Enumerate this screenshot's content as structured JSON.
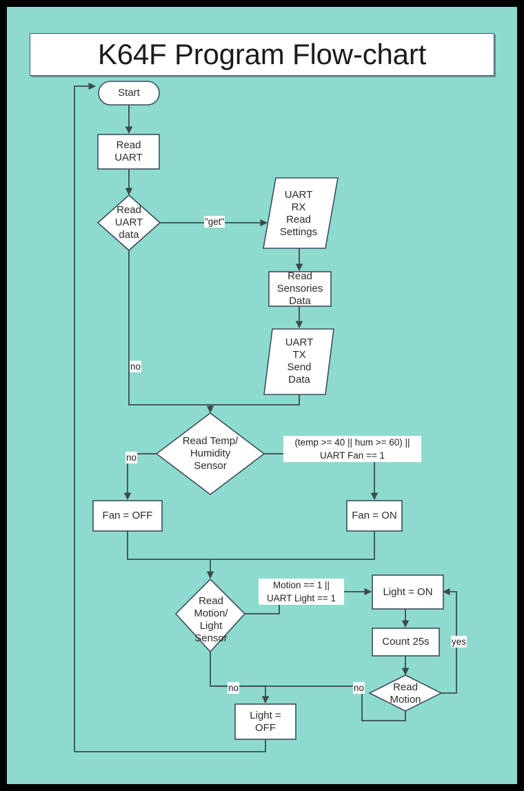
{
  "page": {
    "background_color": "#8ddbce",
    "border_color": "#000000",
    "shape_fill": "#ffffff",
    "shape_stroke": "#3f4a60",
    "connector_color": "#3c4a4a",
    "text_color": "#2b2b2b"
  },
  "title": {
    "text": "K64F Program Flow-chart"
  },
  "nodes": [
    {
      "id": "start",
      "type": "terminator",
      "label": "Start"
    },
    {
      "id": "read_uart",
      "type": "process",
      "label": "Read\nUART"
    },
    {
      "id": "read_uart_data",
      "type": "decision",
      "label": "Read\nUART\ndata"
    },
    {
      "id": "uart_rx",
      "type": "data",
      "label": "UART\nRX\nRead\nSettings"
    },
    {
      "id": "read_sensors",
      "type": "process",
      "label": "Read\nSensories\nData"
    },
    {
      "id": "uart_tx",
      "type": "data",
      "label": "UART\nTX\nSend\nData"
    },
    {
      "id": "read_temp",
      "type": "decision",
      "label": "Read Temp/\nHumidity\nSensor"
    },
    {
      "id": "fan_off",
      "type": "process",
      "label": "Fan = OFF"
    },
    {
      "id": "fan_on",
      "type": "process",
      "label": "Fan = ON"
    },
    {
      "id": "read_motion_light",
      "type": "decision",
      "label": "Read\nMotion/\nLight\nSensor"
    },
    {
      "id": "light_on",
      "type": "process",
      "label": "Light = ON"
    },
    {
      "id": "count_25s",
      "type": "process",
      "label": "Count 25s"
    },
    {
      "id": "read_motion",
      "type": "decision",
      "label": "Read\nMotion"
    },
    {
      "id": "light_off",
      "type": "process",
      "label": "Light =\nOFF"
    }
  ],
  "edge_labels": [
    {
      "id": "get",
      "text": "\"get\""
    },
    {
      "id": "no_uart",
      "text": "no"
    },
    {
      "id": "no_temp",
      "text": "no"
    },
    {
      "id": "fan_cond",
      "text": "(temp >= 40 || hum >= 60) ||\nUART Fan == 1"
    },
    {
      "id": "light_cond",
      "text": "Motion == 1  ||\nUART Light == 1"
    },
    {
      "id": "no_motion_light",
      "text": "no"
    },
    {
      "id": "no_motion",
      "text": "no"
    },
    {
      "id": "yes_motion",
      "text": "yes"
    }
  ]
}
